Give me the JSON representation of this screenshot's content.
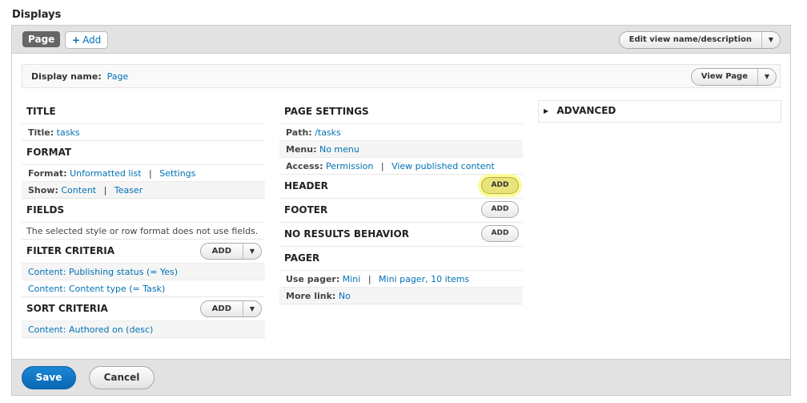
{
  "heading": "Displays",
  "tabs": {
    "page": "Page",
    "add": "Add",
    "add_icon": "+"
  },
  "edit_view_button": {
    "label": "Edit view name/description",
    "caret": "▼"
  },
  "display_name": {
    "label": "Display name:",
    "value": "Page"
  },
  "view_page_button": {
    "label": "View Page",
    "caret": "▼"
  },
  "col1": {
    "title": {
      "heading": "TITLE",
      "k": "Title:",
      "v": "tasks"
    },
    "format": {
      "heading": "FORMAT",
      "format_k": "Format:",
      "format_v": "Unformatted list",
      "format_sep": "|",
      "format_settings": "Settings",
      "show_k": "Show:",
      "show_v": "Content",
      "show_sep": "|",
      "show_teaser": "Teaser"
    },
    "fields": {
      "heading": "FIELDS",
      "text": "The selected style or row format does not use fields."
    },
    "filter": {
      "heading": "FILTER CRITERIA",
      "add": "Add",
      "caret": "▼",
      "items": [
        "Content: Publishing status (= Yes)",
        "Content: Content type (= Task)"
      ]
    },
    "sort": {
      "heading": "SORT CRITERIA",
      "add": "Add",
      "caret": "▼",
      "items": [
        "Content: Authored on (desc)"
      ]
    }
  },
  "col2": {
    "page_settings": {
      "heading": "PAGE SETTINGS",
      "path_k": "Path:",
      "path_v": "/tasks",
      "menu_k": "Menu:",
      "menu_v": "No menu",
      "access_k": "Access:",
      "access_v": "Permission",
      "access_sep": "|",
      "access_v2": "View published content"
    },
    "header": {
      "heading": "HEADER",
      "add": "Add"
    },
    "footer": {
      "heading": "FOOTER",
      "add": "Add"
    },
    "no_results": {
      "heading": "NO RESULTS BEHAVIOR",
      "add": "Add"
    },
    "pager": {
      "heading": "PAGER",
      "use_k": "Use pager:",
      "use_v": "Mini",
      "use_sep": "|",
      "use_v2": "Mini pager, 10 items",
      "more_k": "More link:",
      "more_v": "No"
    }
  },
  "col3": {
    "advanced": {
      "label": "ADVANCED",
      "icon": "▶"
    }
  },
  "actions": {
    "save": "Save",
    "cancel": "Cancel"
  },
  "colors": {
    "link": "#0071b3",
    "save": "#0868b3",
    "highlight": "#e8e47a"
  }
}
